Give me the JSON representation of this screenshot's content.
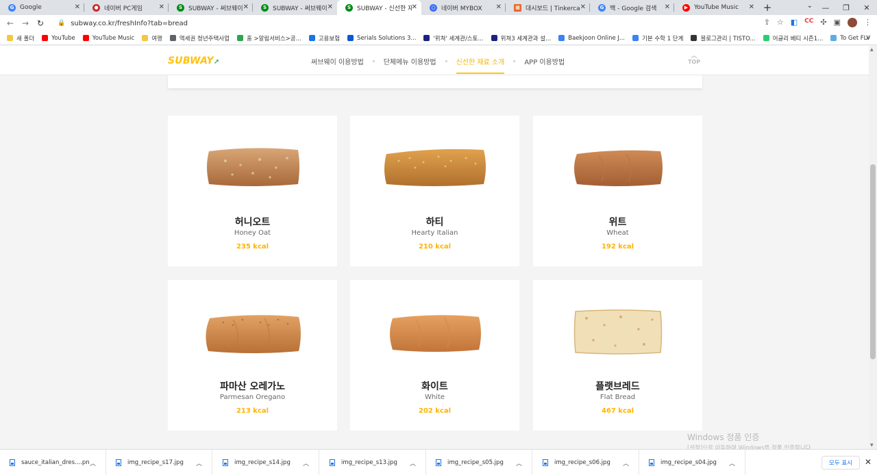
{
  "browser": {
    "tabs": [
      {
        "label": "Google",
        "icon": "google-icon",
        "color": "#4285f4",
        "active": false
      },
      {
        "label": "네이버 PC게임",
        "icon": "naver-game-icon",
        "color": "#e53935",
        "active": false
      },
      {
        "label": "SUBWAY - 써브웨이 이",
        "icon": "subway-icon",
        "color": "#008c15",
        "active": false
      },
      {
        "label": "SUBWAY - 써브웨이 이",
        "icon": "subway-icon",
        "color": "#008c15",
        "active": false
      },
      {
        "label": "SUBWAY - 신선한 재료",
        "icon": "subway-icon",
        "color": "#008c15",
        "active": true
      },
      {
        "label": "네이버 MYBOX",
        "icon": "mybox-icon",
        "color": "#3b6ef5",
        "active": false
      },
      {
        "label": "대시보드 | Tinkercad",
        "icon": "tinkercad-icon",
        "color": "#e86a2b",
        "active": false
      },
      {
        "label": "맥 - Google 검색",
        "icon": "google-icon",
        "color": "#4285f4",
        "active": false
      },
      {
        "label": "YouTube Music",
        "icon": "youtube-music-icon",
        "color": "#ff0000",
        "active": false
      }
    ],
    "url": "subway.co.kr/freshInfo?tab=bread",
    "bookmarks": [
      {
        "label": "새 폴더",
        "color": "#f2c744"
      },
      {
        "label": "YouTube",
        "color": "#ff0000"
      },
      {
        "label": "YouTube Music",
        "color": "#ff0000"
      },
      {
        "label": "여행",
        "color": "#f2c744"
      },
      {
        "label": "역세권 청년주택사업",
        "color": "#5f6368"
      },
      {
        "label": "홈 >알림서비스>공...",
        "color": "#2ea44f"
      },
      {
        "label": "고용보험",
        "color": "#1a73e8"
      },
      {
        "label": "Serials Solutions 3...",
        "color": "#0b57d0"
      },
      {
        "label": "'위쳐' 세계관/스토...",
        "color": "#1a237e"
      },
      {
        "label": "위쳐3 세계관과 설...",
        "color": "#1a237e"
      },
      {
        "label": "Baekjoon Online J...",
        "color": "#3b82f6"
      },
      {
        "label": "기본 수학 1 단계",
        "color": "#3b82f6"
      },
      {
        "label": "블로그관리 | TISTO...",
        "color": "#333333"
      },
      {
        "label": "어글리 베티 시즌1...",
        "color": "#2ecc71"
      },
      {
        "label": "To Get FLV",
        "color": "#5dade2"
      }
    ]
  },
  "site": {
    "logo": {
      "part1": "SUB",
      "part2": "WAY"
    },
    "nav": [
      "써브웨이 이용방법",
      "단체메뉴 이용방법",
      "신선한 재료 소개",
      "APP 이용방법"
    ],
    "nav_active_index": 2,
    "top_label": "TOP"
  },
  "breads": [
    {
      "name_ko": "허니오트",
      "name_en": "Honey Oat",
      "kcal": "235 kcal",
      "style": "honey-oat"
    },
    {
      "name_ko": "하티",
      "name_en": "Hearty Italian",
      "kcal": "210 kcal",
      "style": "hearty"
    },
    {
      "name_ko": "위트",
      "name_en": "Wheat",
      "kcal": "192 kcal",
      "style": "wheat"
    },
    {
      "name_ko": "파마산 오레가노",
      "name_en": "Parmesan Oregano",
      "kcal": "213 kcal",
      "style": "parmesan"
    },
    {
      "name_ko": "화이트",
      "name_en": "White",
      "kcal": "202 kcal",
      "style": "white"
    },
    {
      "name_ko": "플랫브레드",
      "name_en": "Flat Bread",
      "kcal": "467 kcal",
      "style": "flat"
    }
  ],
  "watermark": {
    "line1": "Windows 정품 인증",
    "line2": "[설정]으로 이동하여 Windows를 정품 인증합니다."
  },
  "downloads": {
    "files": [
      "sauce_italian_dres....png",
      "img_recipe_s17.jpg",
      "img_recipe_s14.jpg",
      "img_recipe_s13.jpg",
      "img_recipe_s05.jpg",
      "img_recipe_s06.jpg",
      "img_recipe_s04.jpg"
    ],
    "show_all": "모두 표시"
  },
  "colors": {
    "subway_yellow": "#ffc20e",
    "subway_green": "#009743",
    "kcal": "#ffb300"
  }
}
